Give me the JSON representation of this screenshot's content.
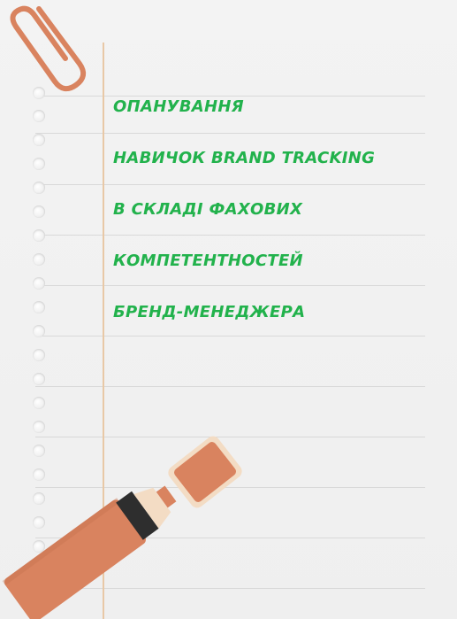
{
  "title_lines": [
    "ОПАНУВАННЯ",
    "НАВИЧОК BRAND TRACKING",
    "В СКЛАДІ ФАХОВИХ",
    "КОМПЕТЕНТНОСТЕЙ",
    "БРЕНД-МЕНЕДЖЕРА"
  ],
  "colors": {
    "text_green": "#22b24c",
    "clip": "#d9835f",
    "marker_body": "#d9835f",
    "marker_cap": "#d9835f",
    "marker_band": "#2e2e2e"
  },
  "icons": [
    "paperclip-icon",
    "highlighter-marker-icon",
    "marker-cap-icon"
  ]
}
